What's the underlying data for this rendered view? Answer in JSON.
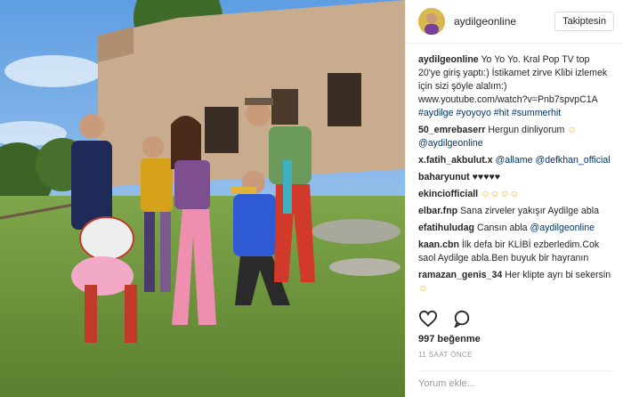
{
  "header": {
    "username": "aydilgeonline",
    "follow_label": "Takiptesin"
  },
  "caption": {
    "user": "aydilgeonline",
    "text": "Yo Yo Yo. Kral Pop TV top 20'ye giriş yaptı:) İstikamet zirve Klibi izlemek için sizi şöyle alalım:) www.youtube.com/watch?v=Pnb7spvpC1A",
    "hashtags": "#aydilge #yoyoyo #hit #summerhit"
  },
  "comments": [
    {
      "user": "50_emrebaserr",
      "text": "Hergun dinliyorum",
      "emoji": "☺",
      "mention": "@aydilgeonline"
    },
    {
      "user": "x.fatih_akbulut.x",
      "mention": "@allame @defkhan_official"
    },
    {
      "user": "baharyunut",
      "emoji": "♥♥♥♥♥"
    },
    {
      "user": "ekinciofficiall",
      "emoji": "☺☺☺☺"
    },
    {
      "user": "elbar.fnp",
      "text": "Sana zirveler yakışır Aydilge abla"
    },
    {
      "user": "efatihuludag",
      "text": "Cansın abla",
      "mention": "@aydilgeonline"
    },
    {
      "user": "kaan.cbn",
      "text": "İlk defa bir KLİBİ ezberledim.Cok saol Aydilge abla.Ben buyuk bir hayranın"
    },
    {
      "user": "ramazan_genis_34",
      "text": "Her klipte ayrı bi sekersin",
      "emoji": "☺"
    }
  ],
  "likes": {
    "count": "997",
    "label": "beğenme"
  },
  "time_ago": "11 SAAT ÖNCE",
  "comment_placeholder": "Yorum ekle...",
  "icons": [
    "heart-icon",
    "comment-icon"
  ]
}
